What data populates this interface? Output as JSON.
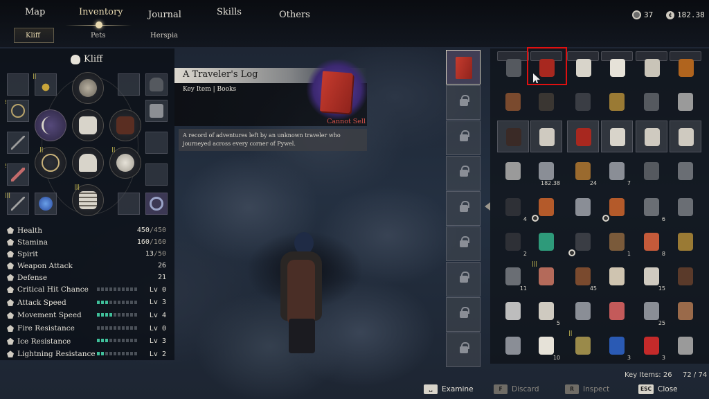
{
  "nav": {
    "tabs": [
      {
        "label": "Map",
        "active": false
      },
      {
        "label": "Inventory",
        "active": true
      },
      {
        "label": "Journal",
        "active": false
      },
      {
        "label": "Skills",
        "active": false
      },
      {
        "label": "Others",
        "active": false
      }
    ],
    "subtabs": [
      {
        "label": "Kliff",
        "active": true
      },
      {
        "label": "Pets",
        "active": false
      },
      {
        "label": "Herspia",
        "active": false
      }
    ],
    "currency": {
      "gems": "37",
      "silver": "182.38"
    }
  },
  "character": {
    "name": "Kliff",
    "stats": [
      {
        "label": "Health",
        "value": "450",
        "max": "/450"
      },
      {
        "label": "Stamina",
        "value": "160",
        "max": "/160"
      },
      {
        "label": "Spirit",
        "value": "13",
        "max": "/50"
      },
      {
        "label": "Weapon Attack",
        "value": "26",
        "max": ""
      },
      {
        "label": "Defense",
        "value": "21",
        "max": ""
      }
    ],
    "levels": [
      {
        "label": "Critical Hit Chance",
        "level": "Lv 0",
        "filled": 0
      },
      {
        "label": "Attack Speed",
        "level": "Lv 3",
        "filled": 3
      },
      {
        "label": "Movement Speed",
        "level": "Lv 4",
        "filled": 4
      },
      {
        "label": "Fire Resistance",
        "level": "Lv 0",
        "filled": 0
      },
      {
        "label": "Ice Resistance",
        "level": "Lv 3",
        "filled": 3
      },
      {
        "label": "Lightning Resistance",
        "level": "Lv 2",
        "filled": 2
      }
    ]
  },
  "tooltip": {
    "title": "A Traveler's Log",
    "category": "Key Item | Books",
    "sell_status": "Cannot Sell",
    "description": "A record of adventures left by an unknown traveler who journeyed across every corner of Pywel."
  },
  "inventory": {
    "quantities": {
      "silver_stack": "182.38",
      "r4_c3": "24",
      "r4_c4": "7",
      "r5_c0": "4",
      "r5_c5": "6",
      "r6_c0": "2",
      "r6_c3": "1",
      "r6_c4": "8",
      "r7_c0": "11",
      "r7_c2": "45",
      "r7_c4": "15",
      "r8_c1": "5",
      "r8_c4": "25",
      "r9_c1": "10",
      "r9_c3": "3",
      "r9_c4": "3"
    },
    "key_items_label": "Key Items: 26",
    "capacity": "72 / 74"
  },
  "hints": [
    {
      "key": "␣",
      "label": "Examine",
      "enabled": true
    },
    {
      "key": "F",
      "label": "Discard",
      "enabled": false
    },
    {
      "key": "R",
      "label": "Inspect",
      "enabled": false
    },
    {
      "key": "ESC",
      "label": "Close",
      "enabled": true
    }
  ],
  "colors": {
    "accent": "#e8d9b0",
    "bar_on": "#3fbf9a",
    "warning": "#d9534a",
    "selection": "#e01010"
  }
}
